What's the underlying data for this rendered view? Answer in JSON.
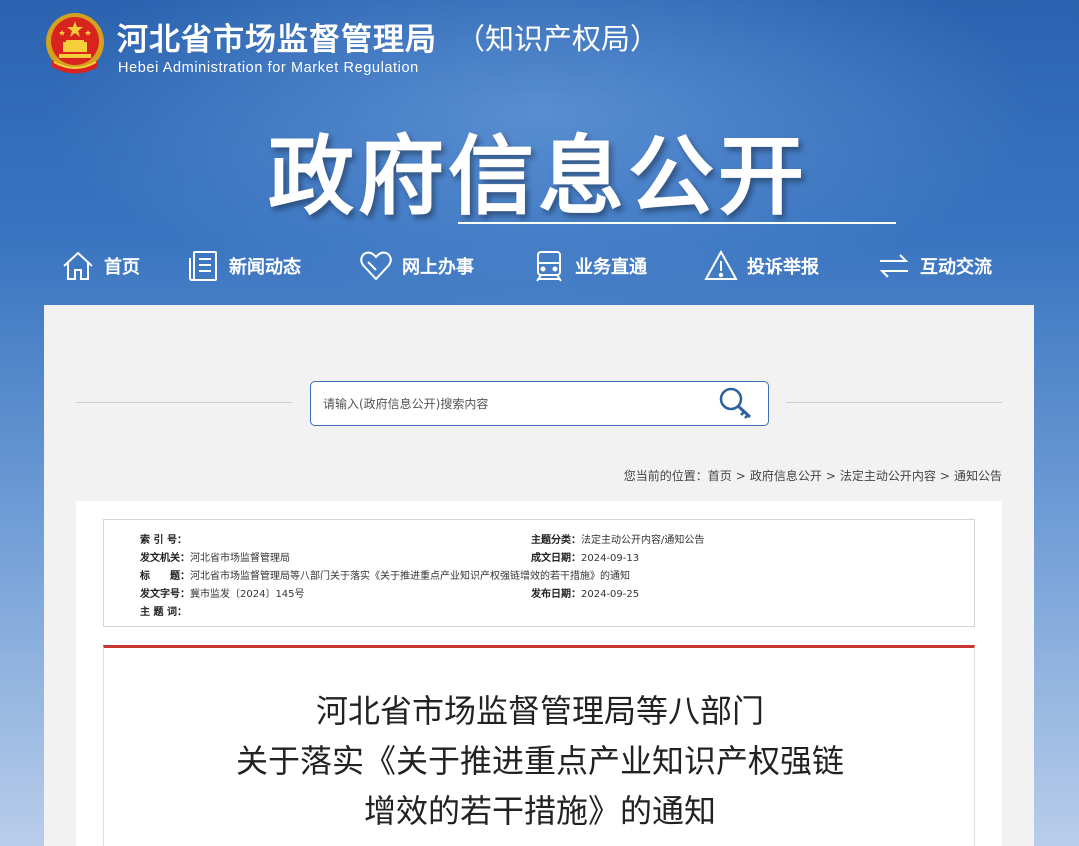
{
  "header": {
    "title_zh": "河北省市场监督管理局",
    "title_sub": "（知识产权局）",
    "title_en": "Hebei Administration for Market Regulation",
    "banner": "政府信息公开"
  },
  "nav": [
    {
      "label": "首页",
      "icon": "home-icon"
    },
    {
      "label": "新闻动态",
      "icon": "news-icon"
    },
    {
      "label": "网上办事",
      "icon": "heart-icon"
    },
    {
      "label": "业务直通",
      "icon": "train-icon"
    },
    {
      "label": "投诉举报",
      "icon": "warning-icon"
    },
    {
      "label": "互动交流",
      "icon": "exchange-icon"
    }
  ],
  "search": {
    "placeholder": "请输入(政府信息公开)搜索内容",
    "icon": "key-search-icon"
  },
  "breadcrumb": {
    "prefix": "您当前的位置：",
    "items": [
      "首页",
      "政府信息公开",
      "法定主动公开内容",
      "通知公告"
    ],
    "separator": ">"
  },
  "meta": {
    "index_label": "索 引 号：",
    "index_value": "",
    "issuer_label": "发文机关：",
    "issuer_value": "河北省市场监督管理局",
    "title_label": "标　　题：",
    "title_value": "河北省市场监督管理局等八部门关于落实《关于推进重点产业知识产权强链增效的若干措施》的通知",
    "docno_label": "发文字号：",
    "docno_value": "冀市监发〔2024〕145号",
    "keywords_label": "主 题 词：",
    "keywords_value": "",
    "category_label": "主题分类：",
    "category_value": "法定主动公开内容/通知公告",
    "created_label": "成文日期：",
    "created_value": "2024-09-13",
    "published_label": "发布日期：",
    "published_value": "2024-09-25"
  },
  "document": {
    "title_lines": [
      "河北省市场监督管理局等八部门",
      "关于落实《关于推进重点产业知识产权强链",
      "增效的若干措施》的通知"
    ]
  },
  "colors": {
    "header_blue": "#2b63b0",
    "accent_red": "#c8342e",
    "search_border": "#3b70b8"
  }
}
